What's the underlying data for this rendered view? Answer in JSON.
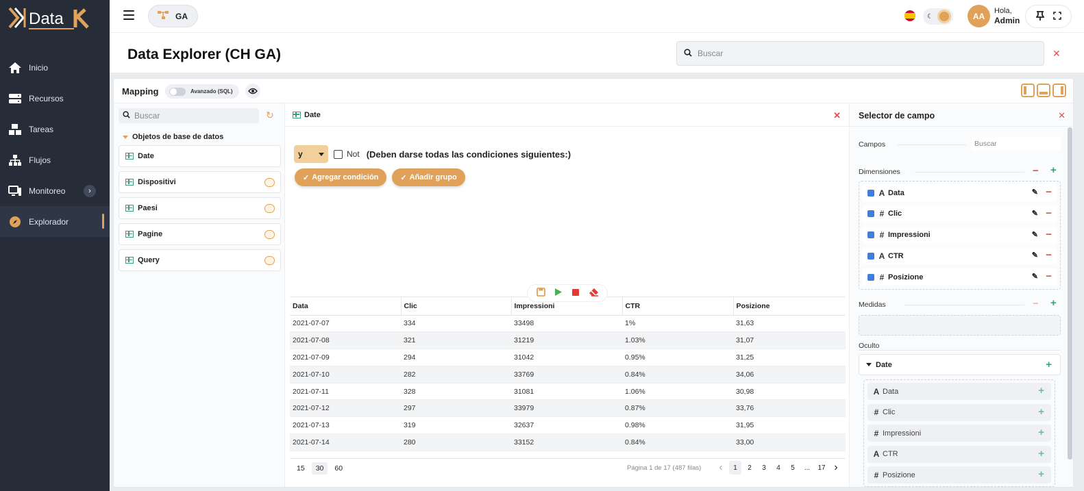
{
  "brand": {
    "logo_text": "Data"
  },
  "sidebar": {
    "items": [
      {
        "label": "Inicio",
        "icon": "home-icon"
      },
      {
        "label": "Recursos",
        "icon": "server-icon"
      },
      {
        "label": "Tareas",
        "icon": "boxes-icon"
      },
      {
        "label": "Flujos",
        "icon": "sitemap-icon"
      },
      {
        "label": "Monitoreo",
        "icon": "monitor-icon"
      },
      {
        "label": "Explorador",
        "icon": "compass-icon"
      }
    ]
  },
  "topbar": {
    "project": "GA",
    "user_greeting": "Hola,",
    "user_name": "Admin",
    "avatar_initials": "AA",
    "accent": "#e0a25a"
  },
  "header": {
    "title": "Data Explorer (CH GA)",
    "search_placeholder": "Buscar"
  },
  "mapping": {
    "label": "Mapping",
    "toggle_label": "Avanzado (SQL)"
  },
  "left_panel": {
    "search_placeholder": "Buscar",
    "tree_title": "Objetos de base de datos",
    "objects": [
      "Date",
      "Dispositivi",
      "Paesi",
      "Pagine",
      "Query"
    ]
  },
  "query": {
    "table": "Date",
    "operator": "y",
    "not_label": "Not",
    "condition_text": "(Deben darse todas las condiciones siguientes:)",
    "add_condition": "Agregar condición",
    "add_group": "Añadir grupo"
  },
  "results": {
    "columns": [
      "Data",
      "Clic",
      "Impressioni",
      "CTR",
      "Posizione"
    ],
    "rows": [
      [
        "2021-07-07",
        "334",
        "33498",
        "1%",
        "31,63"
      ],
      [
        "2021-07-08",
        "321",
        "31219",
        "1.03%",
        "31,07"
      ],
      [
        "2021-07-09",
        "294",
        "31042",
        "0.95%",
        "31,25"
      ],
      [
        "2021-07-10",
        "282",
        "33769",
        "0.84%",
        "34,06"
      ],
      [
        "2021-07-11",
        "328",
        "31081",
        "1.06%",
        "30,98"
      ],
      [
        "2021-07-12",
        "297",
        "33979",
        "0.87%",
        "33,76"
      ],
      [
        "2021-07-13",
        "319",
        "32637",
        "0.98%",
        "31,95"
      ],
      [
        "2021-07-14",
        "280",
        "33152",
        "0.84%",
        "33,00"
      ]
    ],
    "page_sizes": [
      "15",
      "30",
      "60"
    ],
    "page_info": "Página 1 de 17 (487 filas)",
    "pages": [
      "1",
      "2",
      "3",
      "4",
      "5",
      "...",
      "17"
    ]
  },
  "field_selector": {
    "title": "Selector de campo",
    "fields_label": "Campos",
    "search_placeholder": "Buscar",
    "dimensions_label": "Dimensiones",
    "dimensions": [
      {
        "type": "A",
        "name": "Data"
      },
      {
        "type": "#",
        "name": "Clic"
      },
      {
        "type": "#",
        "name": "Impressioni"
      },
      {
        "type": "A",
        "name": "CTR"
      },
      {
        "type": "#",
        "name": "Posizione"
      }
    ],
    "measures_label": "Medidas",
    "hidden_label": "Oculto",
    "hidden_group": "Date",
    "hidden_fields": [
      {
        "type": "A",
        "name": "Data"
      },
      {
        "type": "#",
        "name": "Clic"
      },
      {
        "type": "#",
        "name": "Impressioni"
      },
      {
        "type": "A",
        "name": "CTR"
      },
      {
        "type": "#",
        "name": "Posizione"
      }
    ]
  }
}
